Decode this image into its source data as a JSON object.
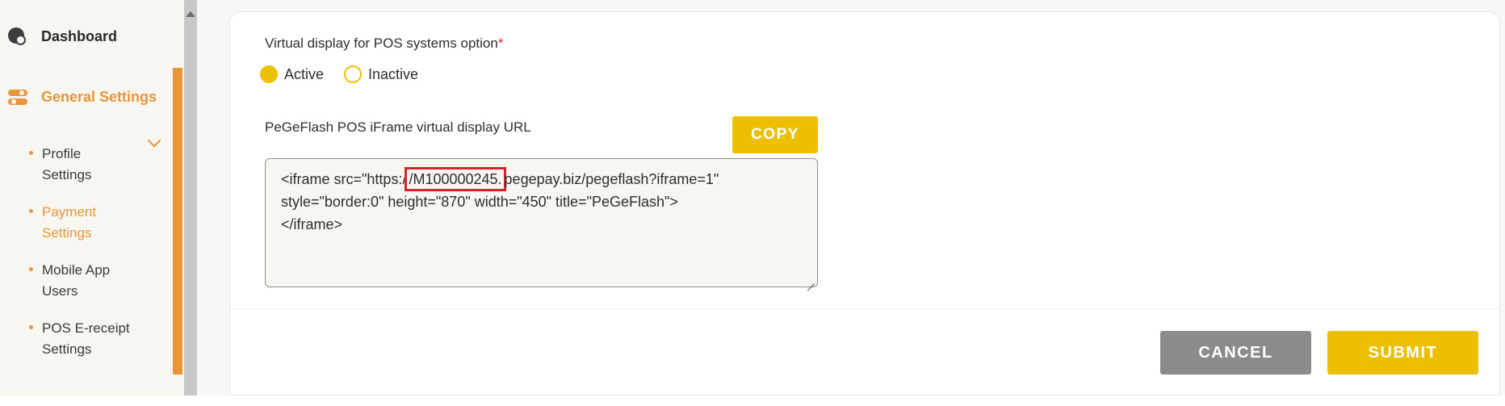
{
  "sidebar": {
    "dashboard": {
      "label": "Dashboard",
      "icon": "dashboard-icon"
    },
    "general_settings": {
      "label": "General Settings",
      "icon": "toggle-icon"
    },
    "sub_items": [
      {
        "line1": "Profile",
        "line2": "Settings",
        "active": false
      },
      {
        "line1": "Payment",
        "line2": "Settings",
        "active": true
      },
      {
        "line1": "Mobile App",
        "line2": "Users",
        "active": false
      },
      {
        "line1": "POS E-receipt",
        "line2": "Settings",
        "active": false
      }
    ]
  },
  "form": {
    "option_label": "Virtual display for POS systems option",
    "required_mark": "*",
    "radio_active": "Active",
    "radio_inactive": "Inactive",
    "selected": "Active",
    "url_label": "PeGeFlash POS iFrame virtual display URL",
    "copy_label": "COPY",
    "iframe_code": {
      "line1_prefix": "<iframe src=\"https:/",
      "line1_highlight": "/M100000245.",
      "line1_suffix": "pegepay.biz/pegeflash?iframe=1\"",
      "line2": "style=\"border:0\" height=\"870\" width=\"450\" title=\"PeGeFlash\">",
      "line3": "</iframe>"
    }
  },
  "footer": {
    "cancel_label": "CANCEL",
    "submit_label": "SUBMIT"
  },
  "colors": {
    "accent_orange": "#e8953a",
    "accent_yellow": "#ecbf00",
    "cancel_gray": "#8b8b8b",
    "highlight_red": "#d9232a"
  }
}
